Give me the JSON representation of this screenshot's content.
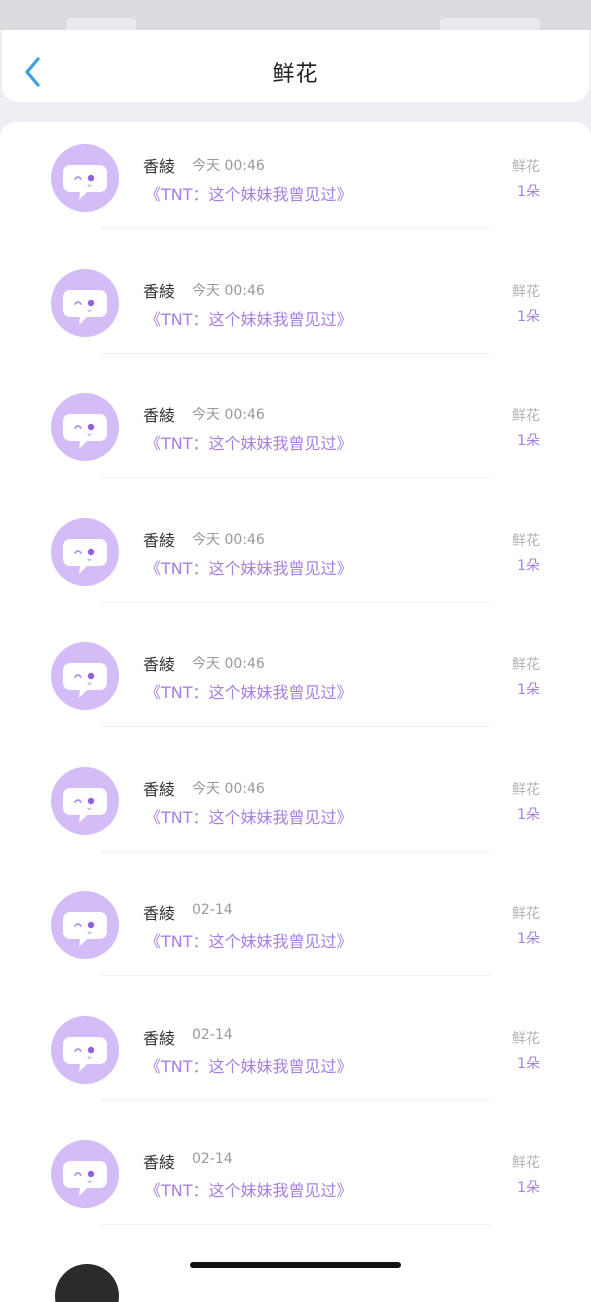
{
  "header": {
    "title": "鲜花"
  },
  "rows": [
    {
      "name": "香綾",
      "time": "今天 00:46",
      "book": "《TNT：这个妹妹我曾见过》",
      "gift": "鲜花",
      "count": "1朵"
    },
    {
      "name": "香綾",
      "time": "今天 00:46",
      "book": "《TNT：这个妹妹我曾见过》",
      "gift": "鲜花",
      "count": "1朵"
    },
    {
      "name": "香綾",
      "time": "今天 00:46",
      "book": "《TNT：这个妹妹我曾见过》",
      "gift": "鲜花",
      "count": "1朵"
    },
    {
      "name": "香綾",
      "time": "今天 00:46",
      "book": "《TNT：这个妹妹我曾见过》",
      "gift": "鲜花",
      "count": "1朵"
    },
    {
      "name": "香綾",
      "time": "今天 00:46",
      "book": "《TNT：这个妹妹我曾见过》",
      "gift": "鲜花",
      "count": "1朵"
    },
    {
      "name": "香綾",
      "time": "今天 00:46",
      "book": "《TNT：这个妹妹我曾见过》",
      "gift": "鲜花",
      "count": "1朵"
    },
    {
      "name": "香綾",
      "time": "02-14",
      "book": "《TNT：这个妹妹我曾见过》",
      "gift": "鲜花",
      "count": "1朵"
    },
    {
      "name": "香綾",
      "time": "02-14",
      "book": "《TNT：这个妹妹我曾见过》",
      "gift": "鲜花",
      "count": "1朵"
    },
    {
      "name": "香綾",
      "time": "02-14",
      "book": "《TNT：这个妹妹我曾见过》",
      "gift": "鲜花",
      "count": "1朵"
    }
  ],
  "icons": {
    "back": "chevron-left-icon",
    "avatar": "chat-bubble-face-icon"
  },
  "colors": {
    "accent": "#a77fe0",
    "avatar_bg": "#d4bdf6",
    "back": "#3a9fe3"
  }
}
